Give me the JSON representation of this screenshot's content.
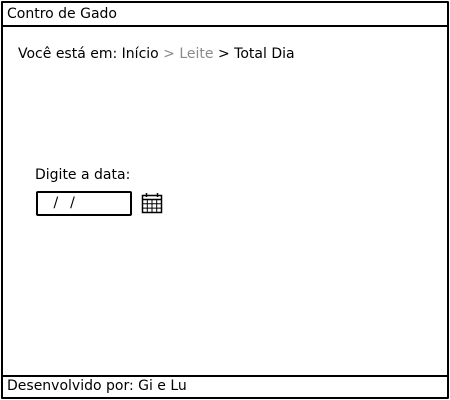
{
  "window": {
    "title": "Contro de Gado"
  },
  "breadcrumb": {
    "prefix": "Você está em:",
    "items": [
      "Início",
      "Leite",
      "Total Dia"
    ],
    "separator": ">"
  },
  "date_form": {
    "label": "Digite a data:",
    "value": " /  /",
    "calendar_icon": "calendar-icon"
  },
  "footer": {
    "text": "Desenvolvido por: Gi e Lu"
  },
  "colors": {
    "text": "#000000",
    "muted_breadcrumb": "#8a8a8a",
    "background": "#ffffff",
    "border": "#000000"
  }
}
